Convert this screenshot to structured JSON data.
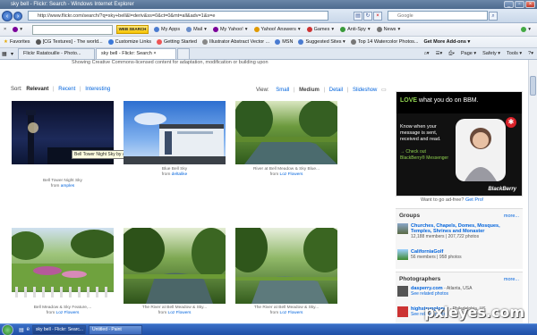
{
  "window": {
    "title": "sky bell - Flickr: Search - Windows Internet Explorer"
  },
  "address": {
    "url": "http://www.flickr.com/search/?q=sky+bell&l=deriv&ss=0&ct=0&mt=all&adv=1&s=e",
    "search_placeholder": "Google"
  },
  "yahoo_toolbar": {
    "search_button": "WEB SEARCH",
    "items": [
      "My Apps",
      "Mail",
      "My Yahoo!",
      "Yahoo! Answers",
      "Games",
      "Anti-Spy",
      "News"
    ]
  },
  "favorites": {
    "label": "Favorites",
    "items": [
      "[CG Textures] - The world...",
      "Customize Links",
      "Getting Started",
      "Illustrator Abstract Vector ...",
      "MSN",
      "Suggested Sites ▾",
      "Top 14 Watercolor Photos...",
      "Get More Add-ons ▾"
    ]
  },
  "tabs": [
    {
      "label": "Flickr Ratatouille - Photo..."
    },
    {
      "label": "sky bell - Flickr: Search"
    }
  ],
  "commands": [
    "Page ▾",
    "Safety ▾",
    "Tools ▾",
    "?▾"
  ],
  "page": {
    "notice": "Showing Creative Commons-licensed content for adaptation, modification or building upon",
    "sort_label": "Sort:",
    "sort_options": [
      "Relevant",
      "Recent",
      "Interesting"
    ],
    "view_label": "View:",
    "view_options": [
      "Small",
      "Medium",
      "Detail",
      "Slideshow"
    ],
    "tooltip": "Bell Tower Night Sky by amples",
    "photos": [
      {
        "title": "Bell Tower Night Sky",
        "by": "amples"
      },
      {
        "title": "Blue Bell Sky",
        "by": "deltalike"
      },
      {
        "title": "River at Bell Meadow & Sky Blue...",
        "by": "Loz Flowers"
      },
      {
        "title": "Bell Meadow & Sky Feature,...",
        "by": "Loz Flowers"
      },
      {
        "title": "The River at Bell Meadow & Sky...",
        "by": "Loz Flowers"
      },
      {
        "title": "The River at Bell Meadow & Sky...",
        "by": "Loz Flowers"
      }
    ],
    "from_label": "from"
  },
  "sidebar": {
    "ad": {
      "headline": "what you do on BBM.",
      "love": "LOVE",
      "body": "Know when your message is sent, received and read.",
      "cta": "→ Check out BlackBerry® Messenger",
      "brand": "BlackBerry",
      "question": "Want to go ad-free?",
      "go_pro": "Get Pro!"
    },
    "groups": {
      "heading": "Groups",
      "more": "more...",
      "items": [
        {
          "name": "Churches, Chapels, Domes, Mosques, Temples, Shrines and Monaster",
          "meta": "12,188 members | 207,722 photos"
        },
        {
          "name": "CaliforniaGolf",
          "meta": "56 members | 958 photos"
        }
      ]
    },
    "photographers": {
      "heading": "Photographers",
      "more": "more...",
      "items": [
        {
          "name": "dasperry.com",
          "loc": "- Atlanta, USA",
          "meta": "See related photos"
        },
        {
          "name": "highstrungloner",
          "loc": "- Philadelphia, US",
          "meta": "See related photos"
        }
      ]
    }
  },
  "taskbar": {
    "items": [
      "sky bell - Flickr: Searc...",
      "Untitled - Paint"
    ]
  },
  "watermark": "pxleyes.com"
}
